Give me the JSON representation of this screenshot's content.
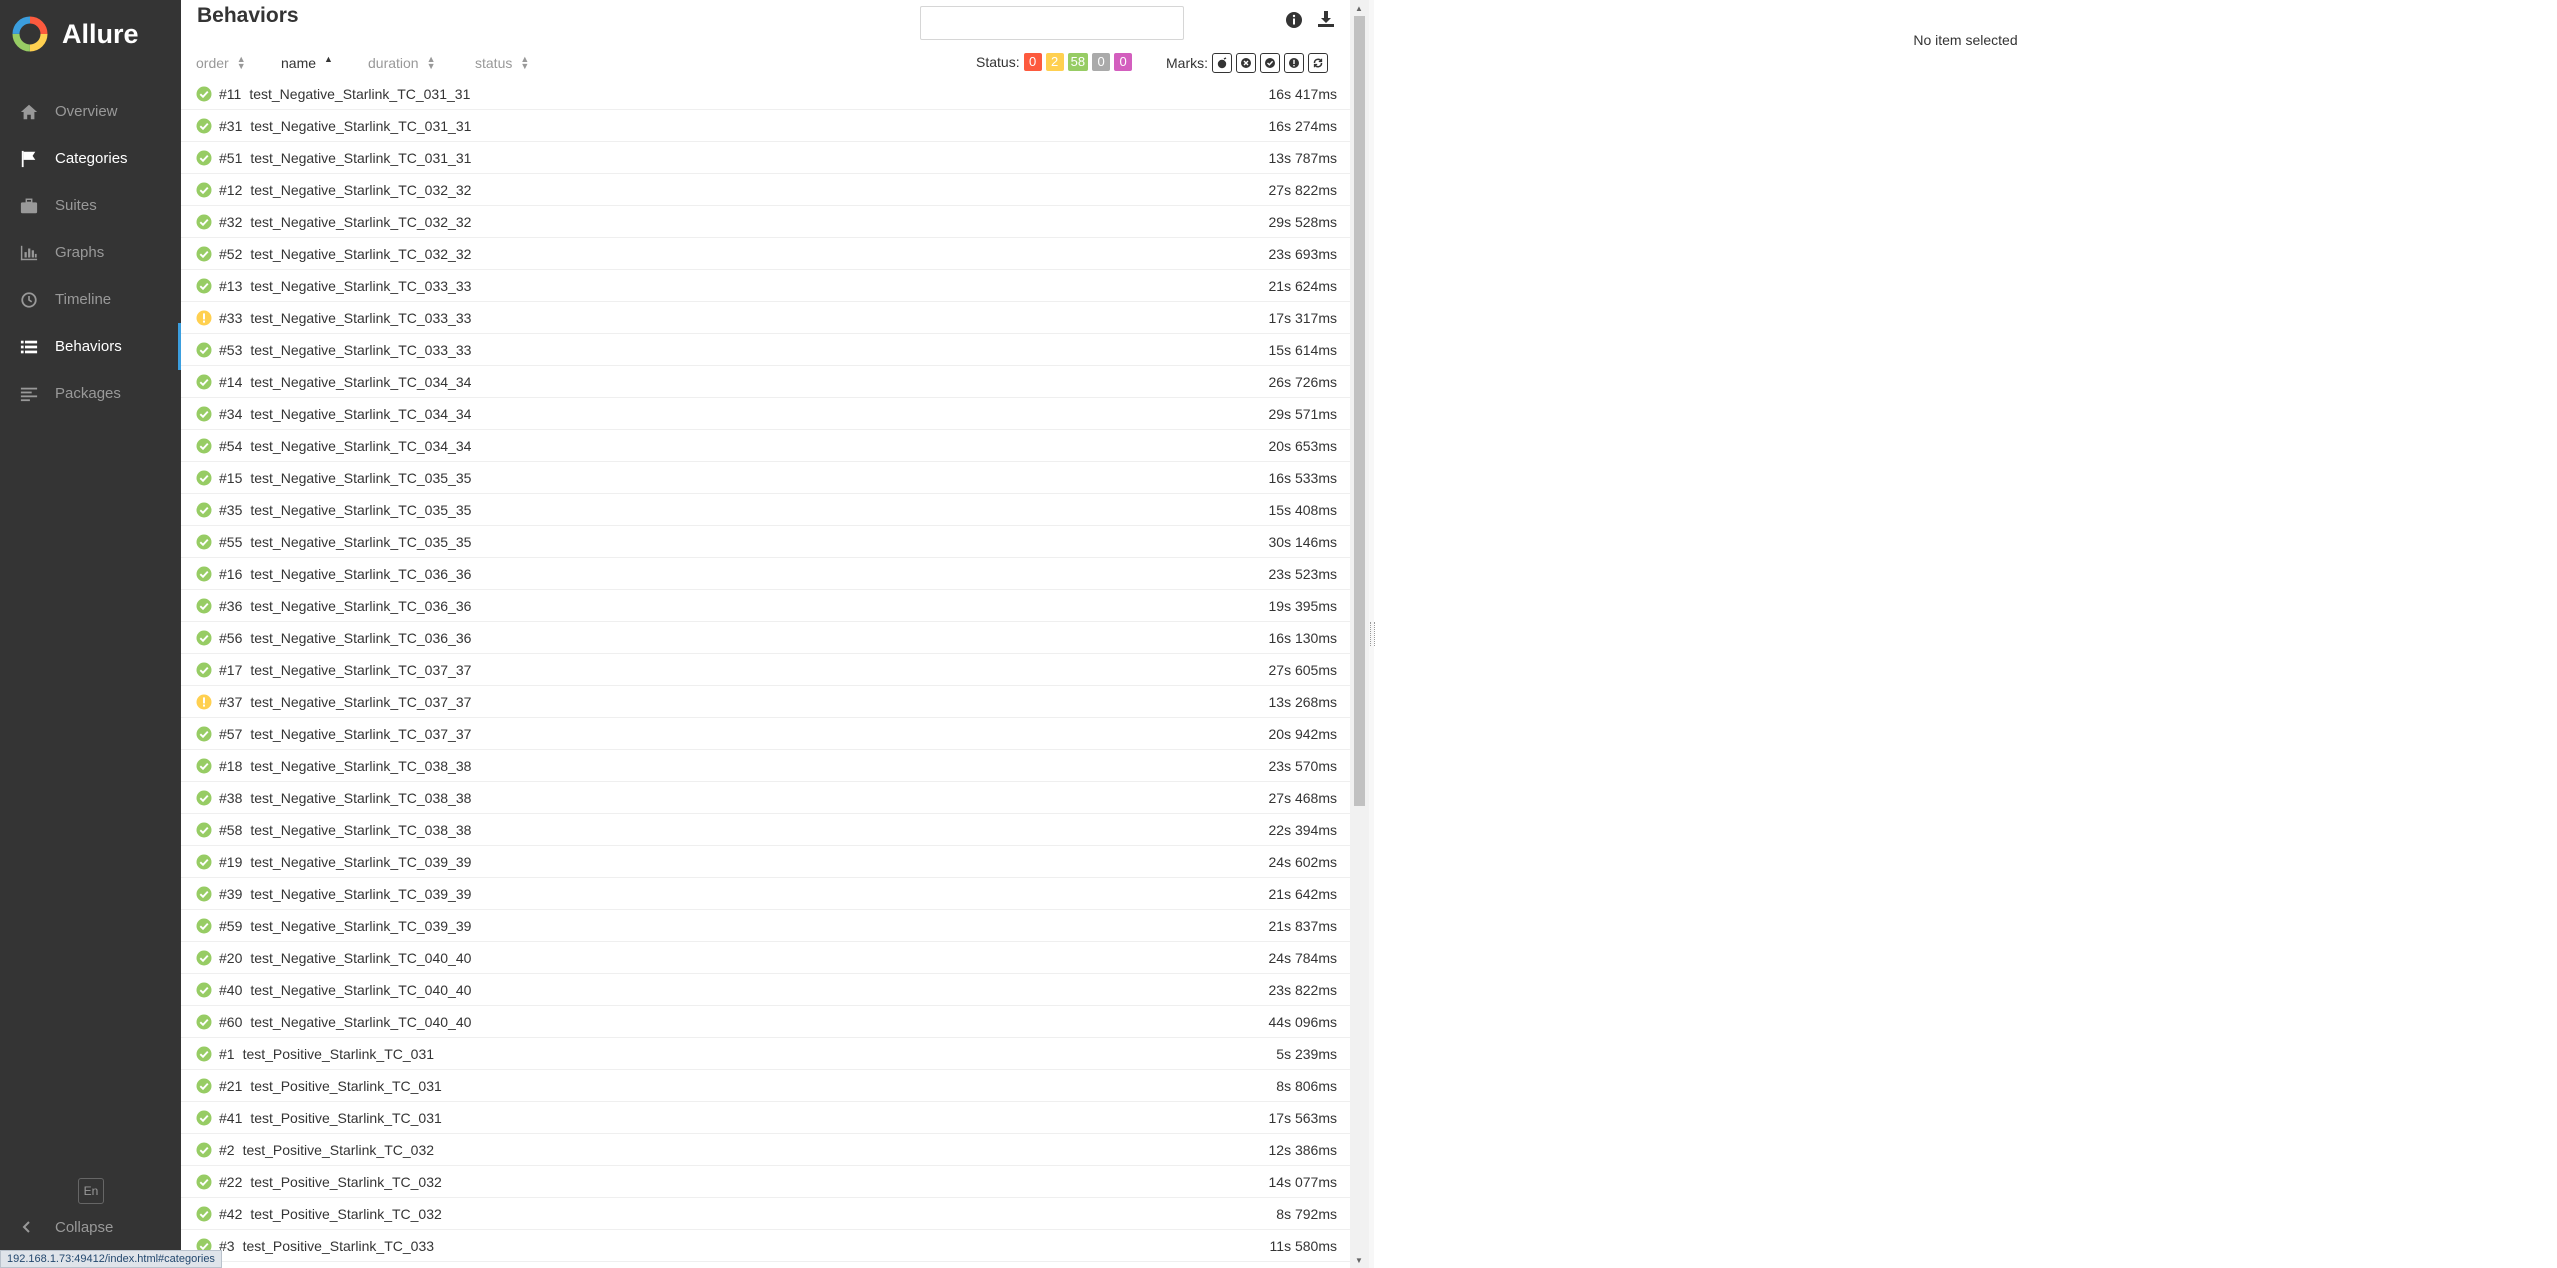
{
  "app": {
    "brand": "Allure"
  },
  "sidebar": {
    "items": [
      {
        "label": "Overview",
        "icon": "home-icon",
        "state": ""
      },
      {
        "label": "Categories",
        "icon": "flag-icon",
        "state": "active"
      },
      {
        "label": "Suites",
        "icon": "briefcase-icon",
        "state": ""
      },
      {
        "label": "Graphs",
        "icon": "bar-chart-icon",
        "state": ""
      },
      {
        "label": "Timeline",
        "icon": "clock-icon",
        "state": ""
      },
      {
        "label": "Behaviors",
        "icon": "list-icon",
        "state": "current"
      },
      {
        "label": "Packages",
        "icon": "align-left-icon",
        "state": ""
      }
    ],
    "language": "En",
    "collapse_label": "Collapse"
  },
  "browser_status_url": "192.168.1.73:49412/index.html#categories",
  "tree": {
    "title": "Behaviors",
    "search_value": "",
    "sorters": {
      "order": "order",
      "name": "name",
      "duration": "duration",
      "status": "status"
    },
    "status_label": "Status:",
    "status_counts": [
      {
        "status": "failed",
        "count": "0",
        "color": "#fd5a3e"
      },
      {
        "status": "broken",
        "count": "2",
        "color": "#ffd050"
      },
      {
        "status": "passed",
        "count": "58",
        "color": "#97cc64"
      },
      {
        "status": "skipped",
        "count": "0",
        "color": "#aaaaaa"
      },
      {
        "status": "unknown",
        "count": "0",
        "color": "#d35ebe"
      }
    ],
    "marks_label": "Marks:",
    "rows": [
      {
        "order": "#11",
        "name": "test_Negative_Starlink_TC_031_31",
        "duration": "16s 417ms",
        "status": "passed"
      },
      {
        "order": "#31",
        "name": "test_Negative_Starlink_TC_031_31",
        "duration": "16s 274ms",
        "status": "passed"
      },
      {
        "order": "#51",
        "name": "test_Negative_Starlink_TC_031_31",
        "duration": "13s 787ms",
        "status": "passed"
      },
      {
        "order": "#12",
        "name": "test_Negative_Starlink_TC_032_32",
        "duration": "27s 822ms",
        "status": "passed"
      },
      {
        "order": "#32",
        "name": "test_Negative_Starlink_TC_032_32",
        "duration": "29s 528ms",
        "status": "passed"
      },
      {
        "order": "#52",
        "name": "test_Negative_Starlink_TC_032_32",
        "duration": "23s 693ms",
        "status": "passed"
      },
      {
        "order": "#13",
        "name": "test_Negative_Starlink_TC_033_33",
        "duration": "21s 624ms",
        "status": "passed"
      },
      {
        "order": "#33",
        "name": "test_Negative_Starlink_TC_033_33",
        "duration": "17s 317ms",
        "status": "broken"
      },
      {
        "order": "#53",
        "name": "test_Negative_Starlink_TC_033_33",
        "duration": "15s 614ms",
        "status": "passed"
      },
      {
        "order": "#14",
        "name": "test_Negative_Starlink_TC_034_34",
        "duration": "26s 726ms",
        "status": "passed"
      },
      {
        "order": "#34",
        "name": "test_Negative_Starlink_TC_034_34",
        "duration": "29s 571ms",
        "status": "passed"
      },
      {
        "order": "#54",
        "name": "test_Negative_Starlink_TC_034_34",
        "duration": "20s 653ms",
        "status": "passed"
      },
      {
        "order": "#15",
        "name": "test_Negative_Starlink_TC_035_35",
        "duration": "16s 533ms",
        "status": "passed"
      },
      {
        "order": "#35",
        "name": "test_Negative_Starlink_TC_035_35",
        "duration": "15s 408ms",
        "status": "passed"
      },
      {
        "order": "#55",
        "name": "test_Negative_Starlink_TC_035_35",
        "duration": "30s 146ms",
        "status": "passed"
      },
      {
        "order": "#16",
        "name": "test_Negative_Starlink_TC_036_36",
        "duration": "23s 523ms",
        "status": "passed"
      },
      {
        "order": "#36",
        "name": "test_Negative_Starlink_TC_036_36",
        "duration": "19s 395ms",
        "status": "passed"
      },
      {
        "order": "#56",
        "name": "test_Negative_Starlink_TC_036_36",
        "duration": "16s 130ms",
        "status": "passed"
      },
      {
        "order": "#17",
        "name": "test_Negative_Starlink_TC_037_37",
        "duration": "27s 605ms",
        "status": "passed"
      },
      {
        "order": "#37",
        "name": "test_Negative_Starlink_TC_037_37",
        "duration": "13s 268ms",
        "status": "broken"
      },
      {
        "order": "#57",
        "name": "test_Negative_Starlink_TC_037_37",
        "duration": "20s 942ms",
        "status": "passed"
      },
      {
        "order": "#18",
        "name": "test_Negative_Starlink_TC_038_38",
        "duration": "23s 570ms",
        "status": "passed"
      },
      {
        "order": "#38",
        "name": "test_Negative_Starlink_TC_038_38",
        "duration": "27s 468ms",
        "status": "passed"
      },
      {
        "order": "#58",
        "name": "test_Negative_Starlink_TC_038_38",
        "duration": "22s 394ms",
        "status": "passed"
      },
      {
        "order": "#19",
        "name": "test_Negative_Starlink_TC_039_39",
        "duration": "24s 602ms",
        "status": "passed"
      },
      {
        "order": "#39",
        "name": "test_Negative_Starlink_TC_039_39",
        "duration": "21s 642ms",
        "status": "passed"
      },
      {
        "order": "#59",
        "name": "test_Negative_Starlink_TC_039_39",
        "duration": "21s 837ms",
        "status": "passed"
      },
      {
        "order": "#20",
        "name": "test_Negative_Starlink_TC_040_40",
        "duration": "24s 784ms",
        "status": "passed"
      },
      {
        "order": "#40",
        "name": "test_Negative_Starlink_TC_040_40",
        "duration": "23s 822ms",
        "status": "passed"
      },
      {
        "order": "#60",
        "name": "test_Negative_Starlink_TC_040_40",
        "duration": "44s 096ms",
        "status": "passed"
      },
      {
        "order": "#1",
        "name": "test_Positive_Starlink_TC_031",
        "duration": "5s 239ms",
        "status": "passed"
      },
      {
        "order": "#21",
        "name": "test_Positive_Starlink_TC_031",
        "duration": "8s 806ms",
        "status": "passed"
      },
      {
        "order": "#41",
        "name": "test_Positive_Starlink_TC_031",
        "duration": "17s 563ms",
        "status": "passed"
      },
      {
        "order": "#2",
        "name": "test_Positive_Starlink_TC_032",
        "duration": "12s 386ms",
        "status": "passed"
      },
      {
        "order": "#22",
        "name": "test_Positive_Starlink_TC_032",
        "duration": "14s 077ms",
        "status": "passed"
      },
      {
        "order": "#42",
        "name": "test_Positive_Starlink_TC_032",
        "duration": "8s 792ms",
        "status": "passed"
      },
      {
        "order": "#3",
        "name": "test_Positive_Starlink_TC_033",
        "duration": "11s 580ms",
        "status": "passed"
      }
    ]
  },
  "details": {
    "empty_text": "No item selected"
  },
  "colors": {
    "passed": "#97cc64",
    "broken": "#ffd050",
    "accent": "#3b9ede",
    "sidebar_bg": "#343434"
  }
}
